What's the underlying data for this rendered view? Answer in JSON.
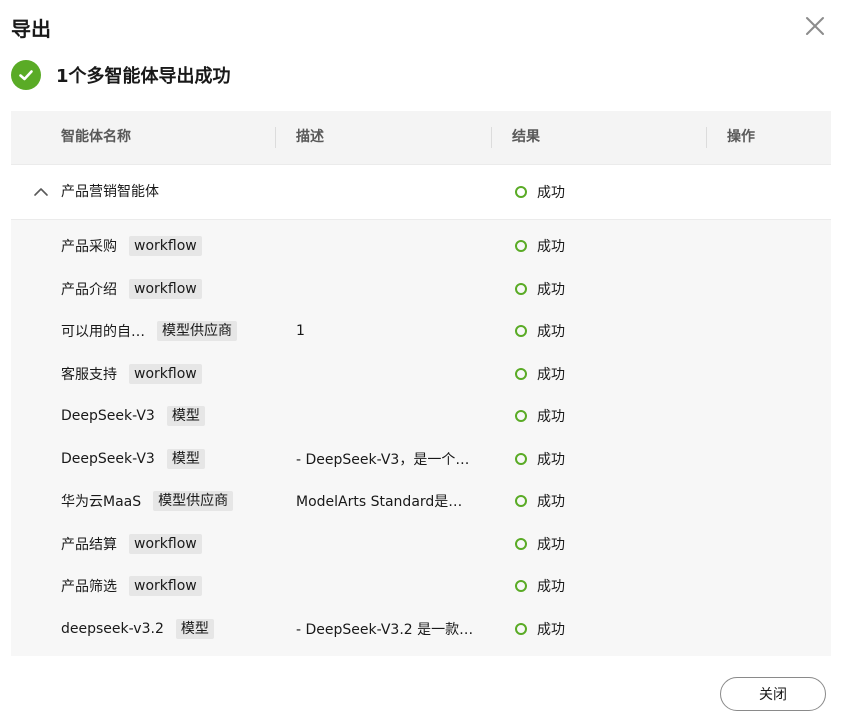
{
  "dialog": {
    "title": "导出",
    "success_message": "1个多智能体导出成功",
    "close_button_label": "关闭"
  },
  "table": {
    "columns": [
      "智能体名称",
      "描述",
      "结果",
      "操作"
    ],
    "group": {
      "name": "产品营销智能体",
      "result": "成功",
      "expanded": true
    },
    "rows": [
      {
        "name": "产品采购",
        "tag": "workflow",
        "description": "",
        "result": "成功"
      },
      {
        "name": "产品介绍",
        "tag": "workflow",
        "description": "",
        "result": "成功"
      },
      {
        "name": "可以用的自…",
        "tag": "模型供应商",
        "description": "1",
        "result": "成功"
      },
      {
        "name": "客服支持",
        "tag": "workflow",
        "description": "",
        "result": "成功"
      },
      {
        "name": "DeepSeek-V3",
        "tag": "模型",
        "description": "",
        "result": "成功"
      },
      {
        "name": "DeepSeek-V3",
        "tag": "模型",
        "description": "- DeepSeek-V3，是一个…",
        "result": "成功"
      },
      {
        "name": "华为云MaaS",
        "tag": "模型供应商",
        "description": "ModelArts Standard是…",
        "result": "成功"
      },
      {
        "name": "产品结算",
        "tag": "workflow",
        "description": "",
        "result": "成功"
      },
      {
        "name": "产品筛选",
        "tag": "workflow",
        "description": "",
        "result": "成功"
      },
      {
        "name": "deepseek-v3.2",
        "tag": "模型",
        "description": "- DeepSeek-V3.2 是一款…",
        "result": "成功"
      }
    ]
  },
  "icons": {
    "close": "close-icon",
    "success": "check-circle-icon",
    "collapse": "chevron-up-icon",
    "status": "status-dot-icon"
  },
  "colors": {
    "success_green": "#5aab26",
    "table_background": "#f7f7f7",
    "tag_background": "#e6e6e6"
  }
}
